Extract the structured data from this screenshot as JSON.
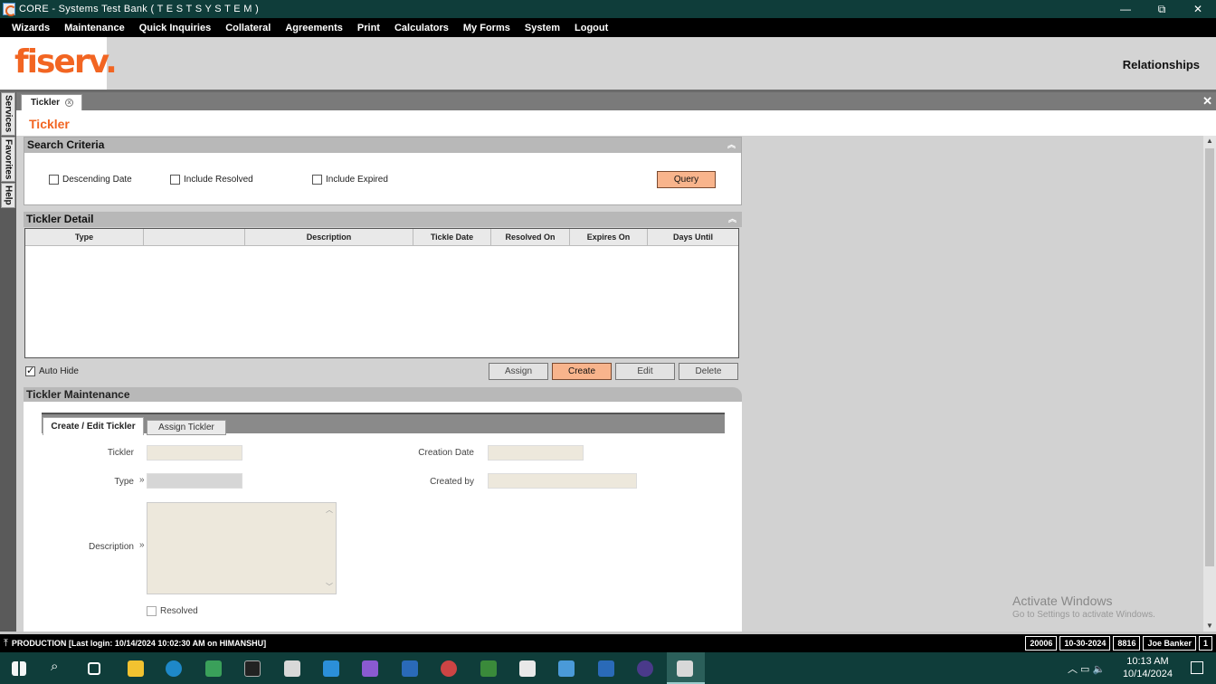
{
  "window": {
    "title": "CORE - Systems Test Bank ( T E S T   S Y S T E M )",
    "min": "—",
    "max": "⧉",
    "close": "✕"
  },
  "menu": [
    "Wizards",
    "Maintenance",
    "Quick Inquiries",
    "Collateral",
    "Agreements",
    "Print",
    "Calculators",
    "My Forms",
    "System",
    "Logout"
  ],
  "header": {
    "logo": "fiserv.",
    "section": "Relationships"
  },
  "side_tabs": [
    "Services",
    "Favorites",
    "Help"
  ],
  "doc_tab": {
    "label": "Tickler",
    "close": "x"
  },
  "page_title": "Tickler",
  "search": {
    "title": "Search Criteria",
    "options": [
      "Descending Date",
      "Include Resolved",
      "Include Expired"
    ],
    "query_label": "Query"
  },
  "detail": {
    "title": "Tickler Detail",
    "columns": [
      "Type",
      "",
      "Description",
      "Tickle Date",
      "Resolved On",
      "Expires On",
      "Days Until"
    ],
    "auto_hide": "Auto Hide",
    "buttons": [
      "Assign",
      "Create",
      "Edit",
      "Delete"
    ]
  },
  "maintenance": {
    "title": "Tickler Maintenance",
    "tabs": [
      "Create / Edit Tickler",
      "Assign Tickler"
    ],
    "labels": {
      "tickler": "Tickler",
      "type": "Type",
      "description": "Description",
      "creation_date": "Creation Date",
      "created_by": "Created by",
      "resolved": "Resolved"
    }
  },
  "status": {
    "left": "PRODUCTION  [Last login: 10/14/2024 10:02:30 AM on HIMANSHU]",
    "cells": [
      "20006",
      "10-30-2024",
      "8816",
      "Joe  Banker",
      "1"
    ]
  },
  "watermark": {
    "line1": "Activate Windows",
    "line2": "Go to Settings to activate Windows."
  },
  "clock": {
    "time": "10:13 AM",
    "date": "10/14/2024"
  }
}
